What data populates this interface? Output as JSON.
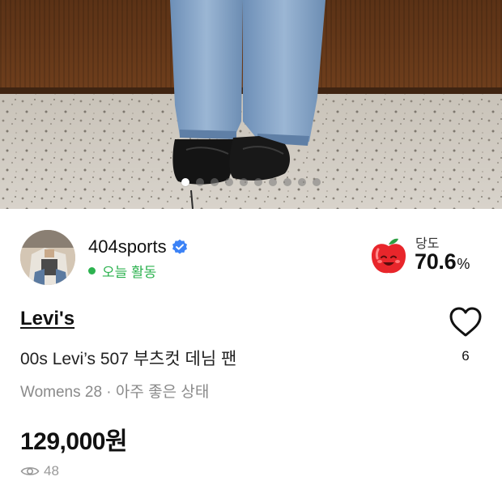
{
  "carousel": {
    "total": 10,
    "active_index": 0
  },
  "seller": {
    "name": "404sports",
    "verified_icon": "verified-check-icon",
    "status_text": "오늘 활동",
    "status_color": "#2cb24f"
  },
  "sweetness": {
    "label": "당도",
    "value": "70.6",
    "unit": "%",
    "icon": "apple-icon"
  },
  "product": {
    "brand": "Levi's",
    "title": "00s Levi’s 507 부츠컷 데님 팬",
    "meta": "Womens 28 · 아주 좋은 상태",
    "price": "129,000원",
    "views": "48",
    "likes": "6"
  }
}
